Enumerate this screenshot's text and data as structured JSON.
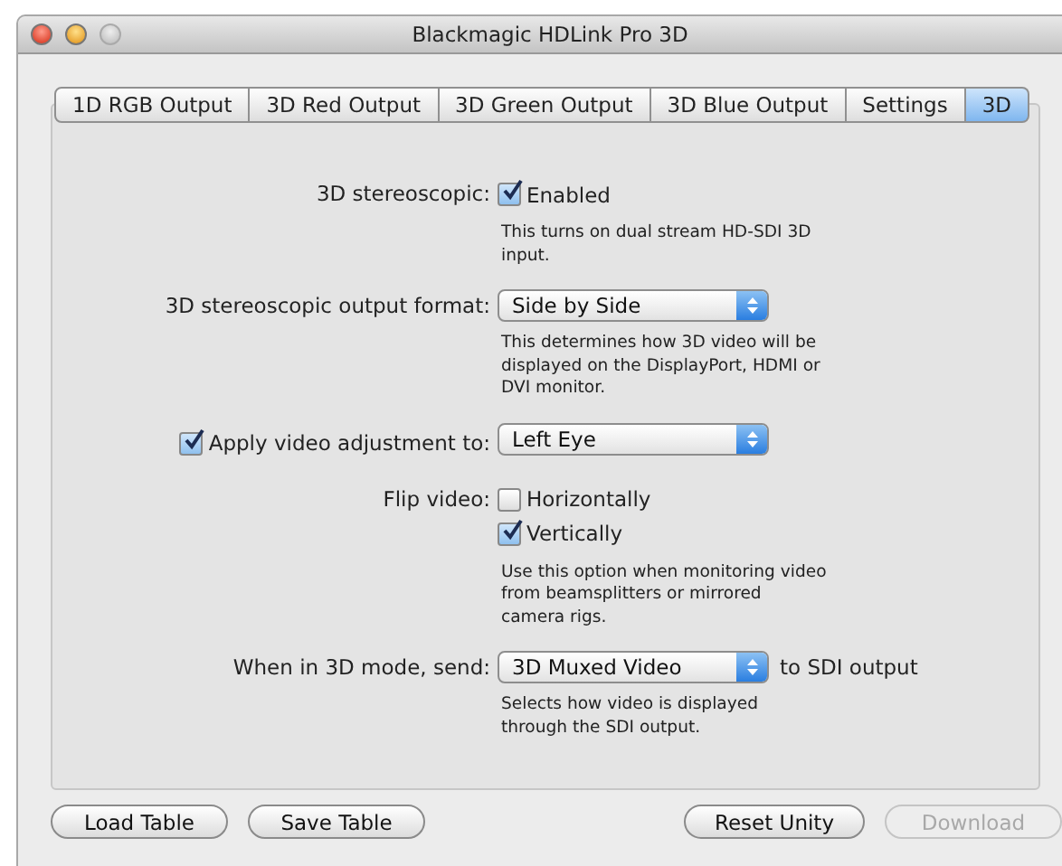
{
  "window": {
    "title": "Blackmagic HDLink Pro 3D"
  },
  "tabs": [
    {
      "label": "1D RGB Output",
      "selected": false
    },
    {
      "label": "3D Red Output",
      "selected": false
    },
    {
      "label": "3D Green Output",
      "selected": false
    },
    {
      "label": "3D Blue Output",
      "selected": false
    },
    {
      "label": "Settings",
      "selected": false
    },
    {
      "label": "3D",
      "selected": true
    }
  ],
  "rows": [
    {
      "kind": "checkbox",
      "label": "3D stereoscopic:",
      "options": [
        {
          "label": "Enabled",
          "checked": true
        }
      ],
      "help": "This turns on dual stream HD-SDI 3D input."
    },
    {
      "kind": "popup",
      "label": "3D stereoscopic output format:",
      "value": "Side by Side",
      "help": "This determines how 3D video will be displayed on the DisplayPort, HDMI or DVI monitor."
    },
    {
      "kind": "checkpopup",
      "label": "Apply video adjustment to:",
      "checked": true,
      "value": "Left Eye"
    },
    {
      "kind": "checkbox",
      "label": "Flip video:",
      "options": [
        {
          "label": "Horizontally",
          "checked": false
        },
        {
          "label": "Vertically",
          "checked": true
        }
      ],
      "help": "Use this option when monitoring video from beamsplitters or mirrored camera rigs."
    },
    {
      "kind": "popup",
      "label": "When in 3D mode, send:",
      "value": "3D Muxed Video",
      "suffix": "to SDI output",
      "help": "Selects how video is displayed through the SDI output."
    }
  ],
  "buttons": [
    {
      "label": "Load Table",
      "disabled": false
    },
    {
      "label": "Save Table",
      "disabled": false
    },
    {
      "label": "Reset Unity",
      "disabled": false
    },
    {
      "label": "Download",
      "disabled": true
    }
  ]
}
